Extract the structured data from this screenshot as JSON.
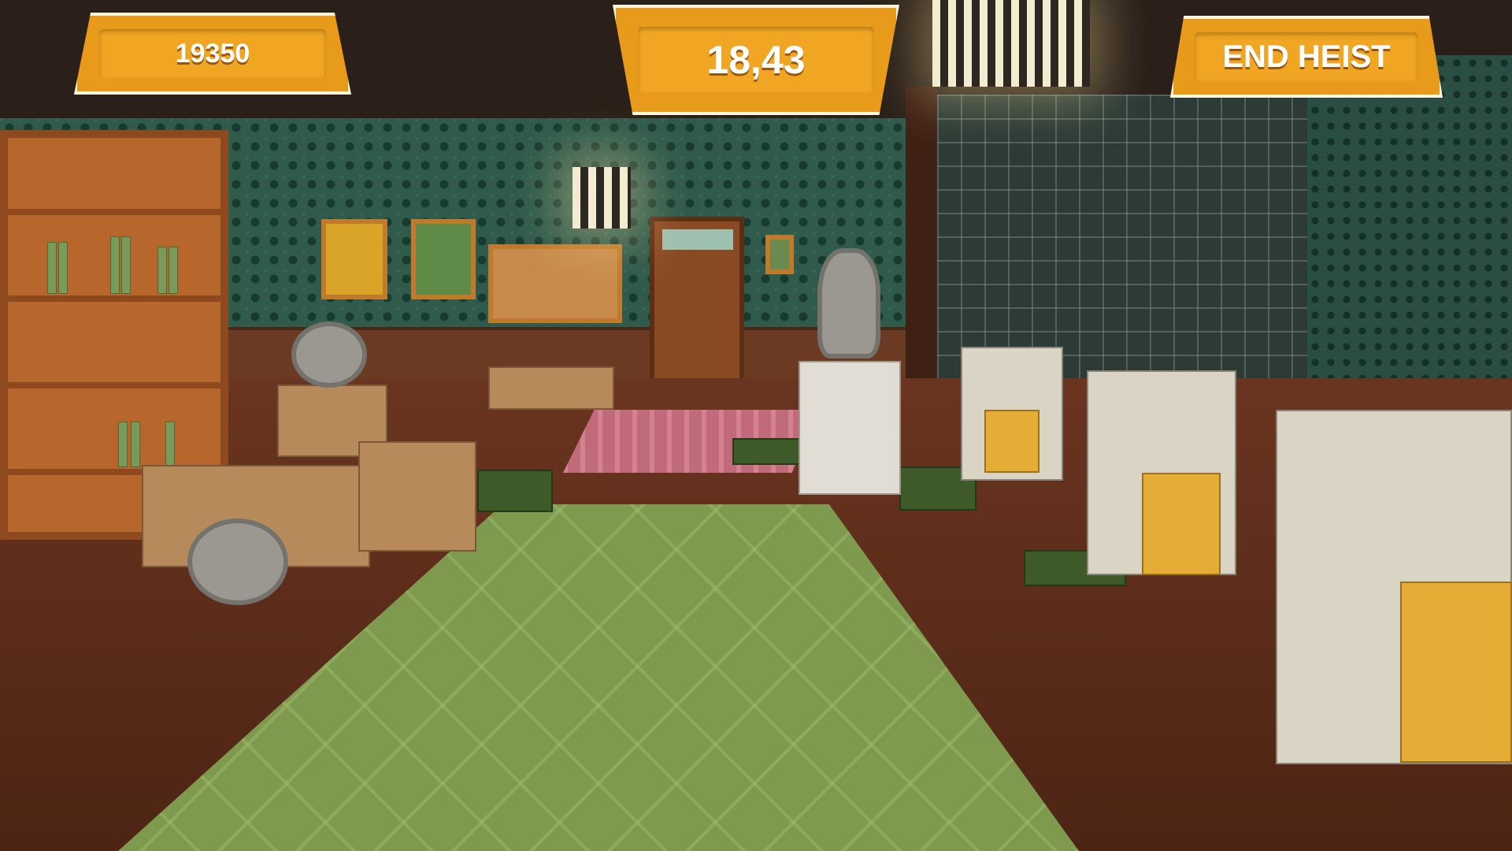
{
  "hud": {
    "score": "19350",
    "timer": "18,43",
    "end_heist_label": "END HEIST"
  },
  "colors": {
    "hud_orange": "#e89a1a",
    "hud_border": "#fff4dd",
    "wall_green": "#2f5a4c",
    "floor_brown": "#6a3520",
    "rug_green": "#7e9a4e"
  },
  "scene": {
    "icons": [
      "coin-icon",
      "cash-stack-icon",
      "bookshelf",
      "door",
      "desk",
      "lamp"
    ]
  }
}
